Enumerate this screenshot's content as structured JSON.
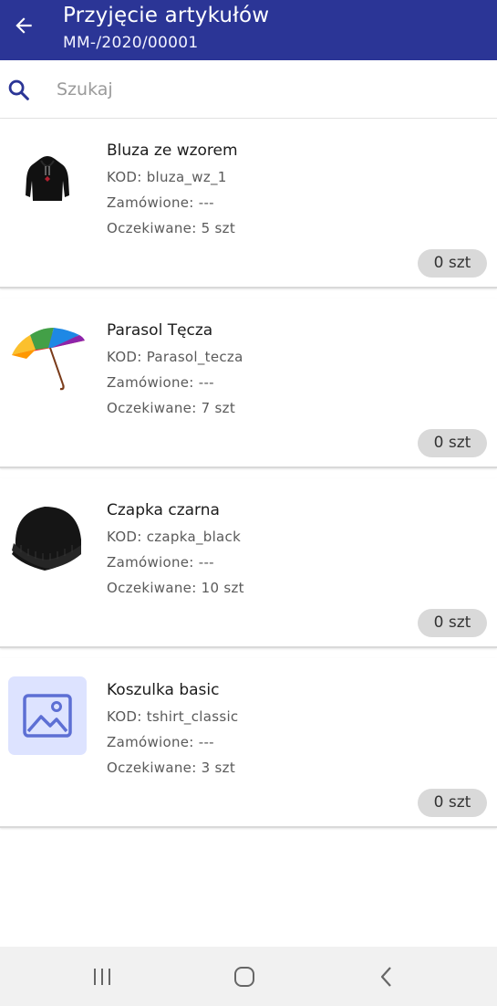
{
  "header": {
    "title": "Przyjęcie artykułów",
    "subtitle": "MM-/2020/00001",
    "color": "#2b3596"
  },
  "search": {
    "placeholder": "Szukaj",
    "value": ""
  },
  "items": [
    {
      "name": "Bluza ze wzorem",
      "code": "KOD: bluza_wz_1",
      "ordered": "Zamówione: ---",
      "expected": "Oczekiwane: 5 szt",
      "qty": "0 szt",
      "image": "hoodie-image"
    },
    {
      "name": "Parasol Tęcza",
      "code": "KOD: Parasol_tecza",
      "ordered": "Zamówione: ---",
      "expected": "Oczekiwane: 7 szt",
      "qty": "0 szt",
      "image": "umbrella-image"
    },
    {
      "name": "Czapka czarna",
      "code": "KOD: czapka_black",
      "ordered": "Zamówione: ---",
      "expected": "Oczekiwane: 10 szt",
      "qty": "0 szt",
      "image": "beanie-image"
    },
    {
      "name": "Koszulka basic",
      "code": "KOD: tshirt_classic",
      "ordered": "Zamówione: ---",
      "expected": "Oczekiwane: 3 szt",
      "qty": "0 szt",
      "image": "image-placeholder-icon"
    }
  ],
  "system_nav": {
    "recents": "recents-icon",
    "home": "home-icon",
    "back": "back-icon"
  }
}
